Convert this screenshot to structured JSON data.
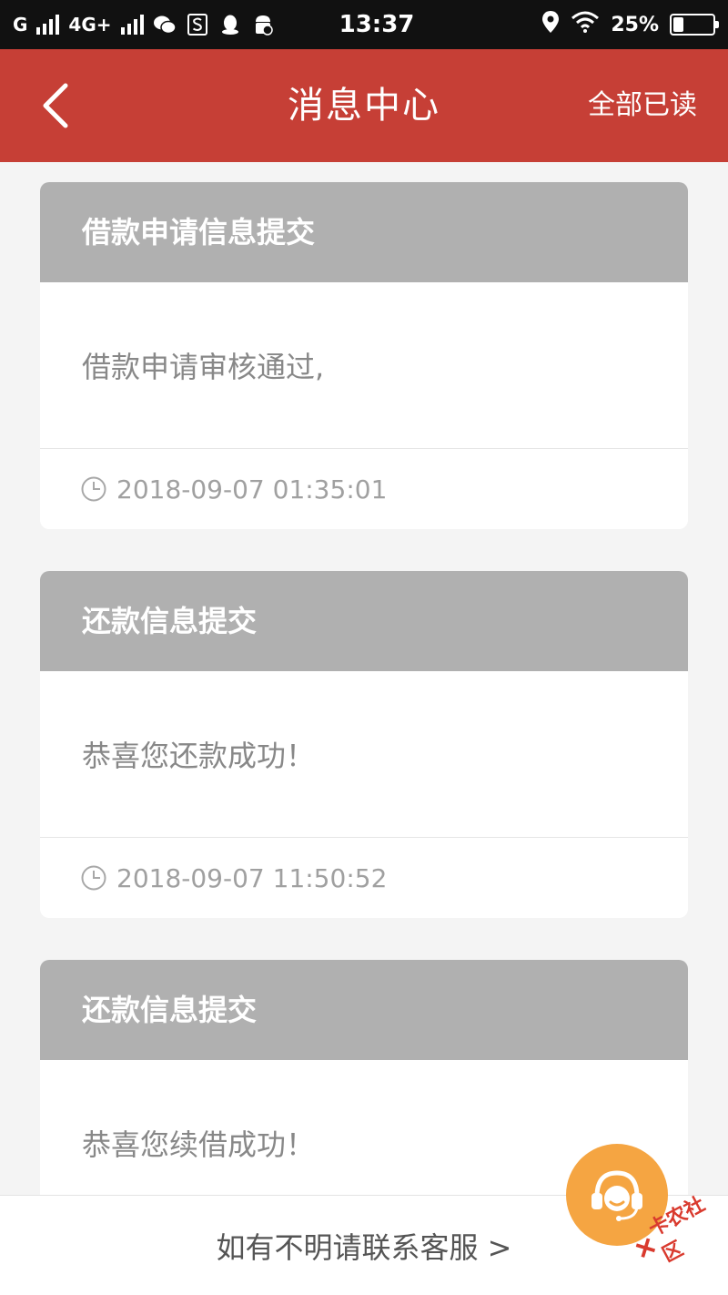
{
  "status_bar": {
    "network_left": "G",
    "network_4g": "4G+",
    "time": "13:37",
    "battery_percent": "25%",
    "battery_level": 0.25
  },
  "header": {
    "title": "消息中心",
    "mark_all_read": "全部已读"
  },
  "messages": [
    {
      "title": "借款申请信息提交",
      "body": "借款申请审核通过,",
      "timestamp": "2018-09-07 01:35:01"
    },
    {
      "title": "还款信息提交",
      "body": "恭喜您还款成功！",
      "timestamp": "2018-09-07 11:50:52"
    },
    {
      "title": "还款信息提交",
      "body": "恭喜您续借成功！"
    }
  ],
  "footer": {
    "contact_text": "如有不明请联系客服 >"
  },
  "watermark": {
    "text": "卡农社区"
  },
  "colors": {
    "header_bg": "#c63f36",
    "card_header_bg": "#b0b0b0",
    "fab_bg": "#f5a542"
  }
}
